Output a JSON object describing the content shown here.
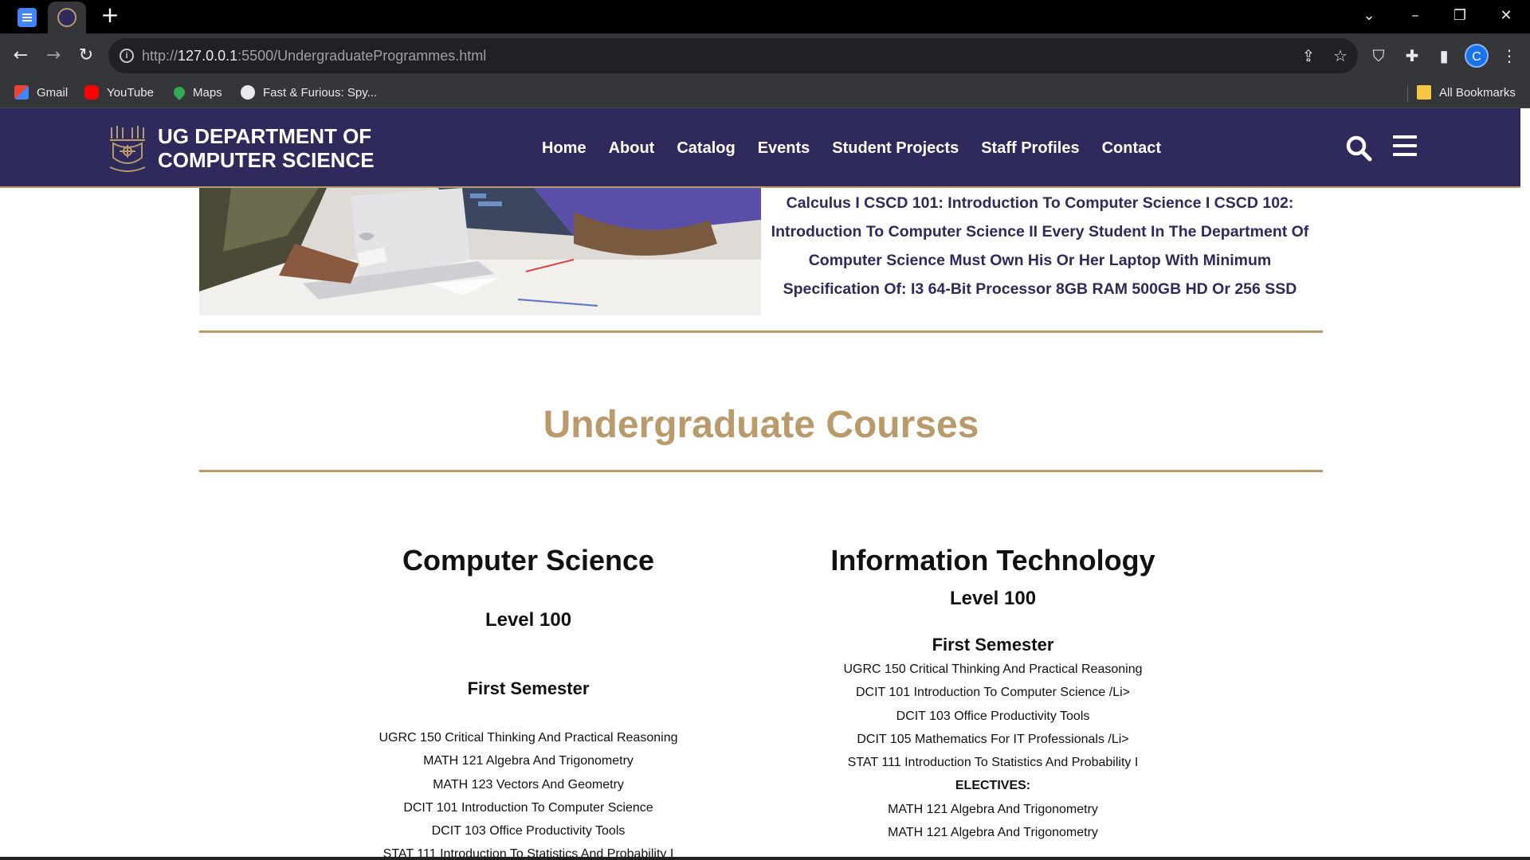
{
  "browser": {
    "url_scheme": "http://",
    "url_host": "127.0.0.1",
    "url_rest": ":5500/UndergraduateProgrammes.html",
    "bookmarks": [
      {
        "label": "Gmail",
        "icon": "gmail-icon"
      },
      {
        "label": "YouTube",
        "icon": "youtube-icon"
      },
      {
        "label": "Maps",
        "icon": "maps-icon"
      },
      {
        "label": "Fast & Furious: Spy...",
        "icon": "globe-icon"
      }
    ],
    "all_bookmarks": "All Bookmarks",
    "profile_initial": "C"
  },
  "header": {
    "brand_line1": "UG DEPARTMENT OF",
    "brand_line2": "COMPUTER SCIENCE",
    "nav": [
      "Home",
      "About",
      "Catalog",
      "Events",
      "Student Projects",
      "Staff Profiles",
      "Contact"
    ]
  },
  "intro": {
    "text": "Calculus I CSCD 101: Introduction To Computer Science I CSCD 102: Introduction To Computer Science II Every Student In The Department Of Computer Science Must Own His Or Her Laptop With Minimum Specification Of: I3 64-Bit Processor 8GB RAM 500GB HD Or 256 SSD"
  },
  "courses": {
    "title": "Undergraduate Courses",
    "cs": {
      "heading": "Computer Science",
      "level": "Level 100",
      "semester": "First Semester",
      "items": [
        "UGRC 150 Critical Thinking And Practical Reasoning",
        "MATH 121 Algebra And Trigonometry",
        "MATH 123 Vectors And Geometry",
        "DCIT 101 Introduction To Computer Science",
        "DCIT 103 Office Productivity Tools",
        "STAT 111 Introduction To Statistics And Probability I"
      ]
    },
    "it": {
      "heading": "Information Technology",
      "level": "Level 100",
      "semester": "First Semester",
      "items": [
        "UGRC 150 Critical Thinking And Practical Reasoning",
        "DCIT 101 Introduction To Computer Science /Li>",
        "DCIT 103 Office Productivity Tools",
        "DCIT 105 Mathematics For IT Professionals /Li>",
        "STAT 111 Introduction To Statistics And Probability I",
        "ELECTIVES:",
        "MATH 121 Algebra And Trigonometry",
        "MATH 121 Algebra And Trigonometry"
      ]
    }
  },
  "colors": {
    "header_bg": "#2e2a5c",
    "accent_gold": "#b99a6b",
    "intro_text": "#2e2a5c"
  }
}
